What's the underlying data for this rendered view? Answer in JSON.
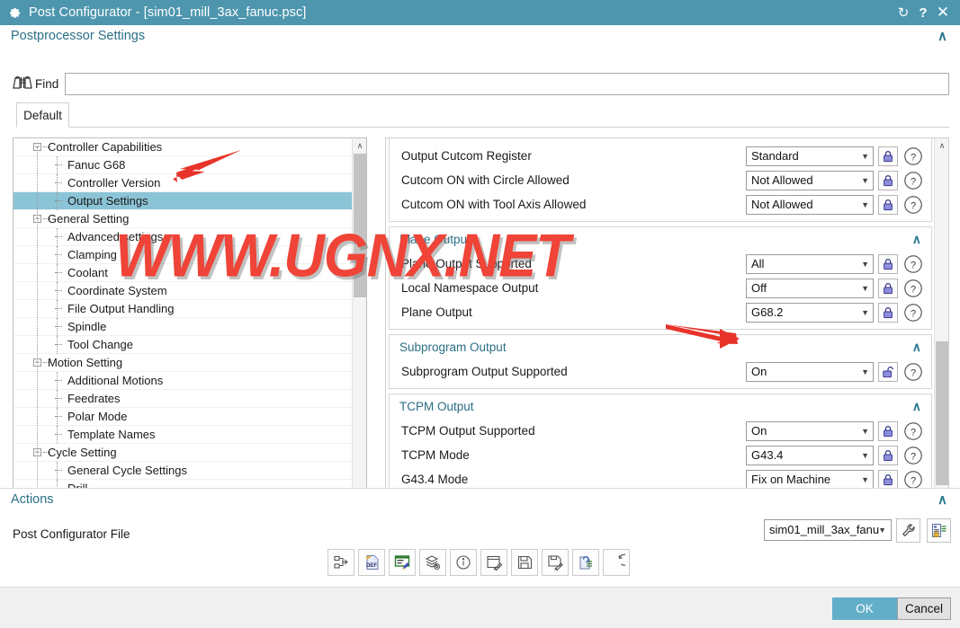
{
  "window": {
    "title": "Post Configurator - [sim01_mill_3ax_fanuc.psc]",
    "gear_icon": "gear-icon",
    "reset_icon": "reset-icon",
    "help_icon": "help-icon",
    "close_icon": "close-icon",
    "accent_color": "#4e96ae",
    "selection_color": "#8cc4d7"
  },
  "postprocessor": {
    "section_title": "Postprocessor Settings",
    "collapse_glyph": "∧",
    "find_label": "Find",
    "find_value": "",
    "find_placeholder": "",
    "find_icon": "binoculars-icon",
    "tabs": [
      {
        "label": "Default",
        "active": true
      }
    ]
  },
  "tree": {
    "nodes": [
      {
        "label": "Controller Capabilities",
        "level": 0,
        "expanded": true,
        "selected": false
      },
      {
        "label": "Fanuc G68",
        "level": 1,
        "expanded": null,
        "selected": false
      },
      {
        "label": "Controller Version",
        "level": 1,
        "expanded": null,
        "selected": false
      },
      {
        "label": "Output Settings",
        "level": 1,
        "expanded": null,
        "selected": true
      },
      {
        "label": "General Setting",
        "level": 0,
        "expanded": true,
        "selected": false
      },
      {
        "label": "Advanced settings",
        "level": 1,
        "expanded": null,
        "selected": false
      },
      {
        "label": "Clamping",
        "level": 1,
        "expanded": null,
        "selected": false
      },
      {
        "label": "Coolant",
        "level": 1,
        "expanded": null,
        "selected": false
      },
      {
        "label": "Coordinate System",
        "level": 1,
        "expanded": null,
        "selected": false
      },
      {
        "label": "File Output Handling",
        "level": 1,
        "expanded": null,
        "selected": false
      },
      {
        "label": "Spindle",
        "level": 1,
        "expanded": null,
        "selected": false
      },
      {
        "label": "Tool Change",
        "level": 1,
        "expanded": null,
        "selected": false
      },
      {
        "label": "Motion Setting",
        "level": 0,
        "expanded": true,
        "selected": false
      },
      {
        "label": "Additional Motions",
        "level": 1,
        "expanded": null,
        "selected": false
      },
      {
        "label": "Feedrates",
        "level": 1,
        "expanded": null,
        "selected": false
      },
      {
        "label": "Polar Mode",
        "level": 1,
        "expanded": null,
        "selected": false
      },
      {
        "label": "Template Names",
        "level": 1,
        "expanded": null,
        "selected": false
      },
      {
        "label": "Cycle Setting",
        "level": 0,
        "expanded": true,
        "selected": false
      },
      {
        "label": "General Cycle Settings",
        "level": 1,
        "expanded": null,
        "selected": false
      },
      {
        "label": "Drill",
        "level": 1,
        "expanded": null,
        "selected": false
      }
    ],
    "scroll_up_glyph": "∧",
    "scroll_down_glyph": "∨"
  },
  "settings": {
    "groups": [
      {
        "title": "",
        "has_header": false,
        "collapse_glyph": "",
        "rows": [
          {
            "label": "Output Cutcom Register",
            "value": "Standard",
            "locked": true
          },
          {
            "label": "Cutcom ON with Circle Allowed",
            "value": "Not Allowed",
            "locked": true
          },
          {
            "label": "Cutcom ON with Tool Axis Allowed",
            "value": "Not Allowed",
            "locked": true
          }
        ]
      },
      {
        "title": "Plane Output",
        "has_header": true,
        "collapse_glyph": "∧",
        "rows": [
          {
            "label": "Plane Output Supported",
            "value": "All",
            "locked": true
          },
          {
            "label": "Local Namespace Output",
            "value": "Off",
            "locked": true
          },
          {
            "label": "Plane Output",
            "value": "G68.2",
            "locked": true
          }
        ]
      },
      {
        "title": "Subprogram Output",
        "has_header": true,
        "collapse_glyph": "∧",
        "rows": [
          {
            "label": "Subprogram Output Supported",
            "value": "On",
            "locked": false
          }
        ]
      },
      {
        "title": "TCPM Output",
        "has_header": true,
        "collapse_glyph": "∧",
        "rows": [
          {
            "label": "TCPM Output Supported",
            "value": "On",
            "locked": true
          },
          {
            "label": "TCPM Mode",
            "value": "G43.4",
            "locked": true
          },
          {
            "label": "G43.4 Mode",
            "value": "Fix on Machine",
            "locked": true
          }
        ]
      }
    ],
    "dropdown_glyph": "▼",
    "help_glyph": "?",
    "scroll_up_glyph": "∧",
    "scroll_down_glyph": "∨"
  },
  "actions": {
    "section_title": "Actions",
    "collapse_glyph": "∧",
    "file_label": "Post Configurator File",
    "icons": [
      {
        "name": "export-structure-icon"
      },
      {
        "name": "def-file-icon"
      },
      {
        "name": "edit-template-icon"
      },
      {
        "name": "layers-settings-icon"
      },
      {
        "name": "info-icon"
      },
      {
        "name": "edit-window-icon"
      },
      {
        "name": "save-icon"
      },
      {
        "name": "save-as-icon"
      },
      {
        "name": "copy-list-icon"
      },
      {
        "name": "undo-icon"
      }
    ],
    "file_combo_value": "sim01_mill_3ax_fanu",
    "wrench_icon": "wrench-icon",
    "secure-list-icon": "secure-list-icon"
  },
  "footer": {
    "ok_label": "OK",
    "cancel_label": "Cancel"
  },
  "watermark": {
    "text": "WWW.UGNX.NET",
    "color": "#ef4437"
  }
}
